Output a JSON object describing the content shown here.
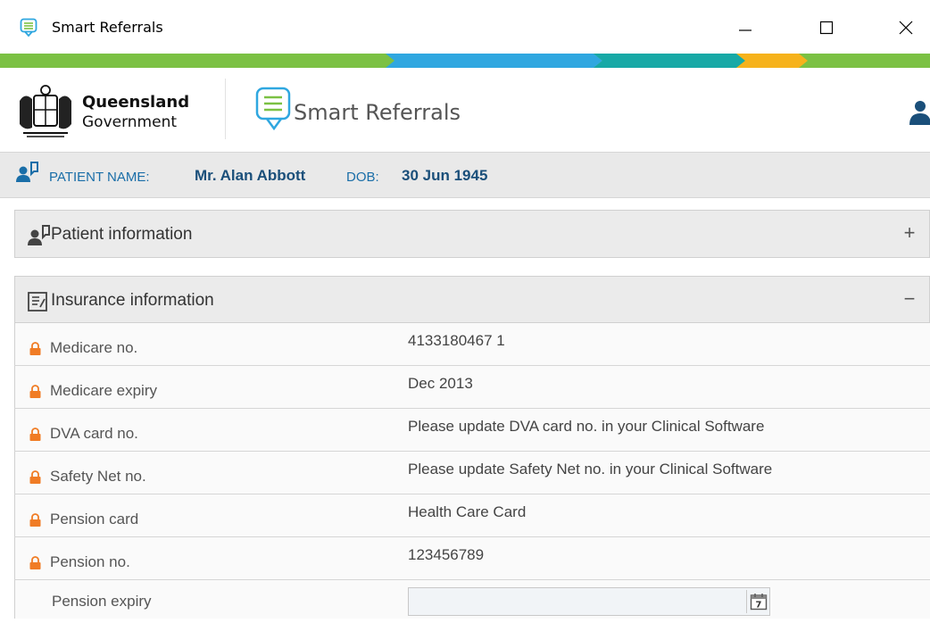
{
  "window": {
    "title": "Smart Referrals"
  },
  "header": {
    "gov_line1": "Queensland",
    "gov_line2": "Government",
    "app_name": "Smart Referrals"
  },
  "patient": {
    "name_label": "PATIENT NAME:",
    "name": "Mr. Alan Abbott",
    "dob_label": "DOB:",
    "dob": "30 Jun 1945"
  },
  "panels": {
    "patient_info": {
      "title": "Patient information",
      "toggle": "+"
    },
    "insurance": {
      "title": "Insurance information",
      "toggle": "−"
    }
  },
  "insurance_rows": [
    {
      "label": "Medicare no.",
      "value": "4133180467 1",
      "locked": true
    },
    {
      "label": "Medicare expiry",
      "value": "Dec 2013",
      "locked": true
    },
    {
      "label": "DVA card no.",
      "value": "Please update DVA card no. in your Clinical Software",
      "locked": true
    },
    {
      "label": "Safety Net no.",
      "value": "Please update Safety Net no. in your Clinical Software",
      "locked": true
    },
    {
      "label": "Pension card",
      "value": "Health Care Card",
      "locked": true
    },
    {
      "label": "Pension no.",
      "value": "123456789",
      "locked": true
    },
    {
      "label": "Pension expiry",
      "value": "",
      "locked": false
    }
  ],
  "icons": {
    "app": "smart-referrals-icon",
    "minimize": "minimize-icon",
    "maximize": "maximize-icon",
    "close": "close-icon",
    "user": "user-icon",
    "patient": "patient-icon",
    "insurance": "insurance-card-icon",
    "lock": "lock-icon",
    "calendar": "calendar-icon"
  },
  "calendar_glyph": "7",
  "colors": {
    "brand_green": "#7bc143",
    "brand_blue": "#2fa7e0",
    "brand_teal": "#17a9a6",
    "brand_orange": "#f6b21b",
    "patient_text": "#1a6ea8",
    "lock": "#f07c25"
  }
}
